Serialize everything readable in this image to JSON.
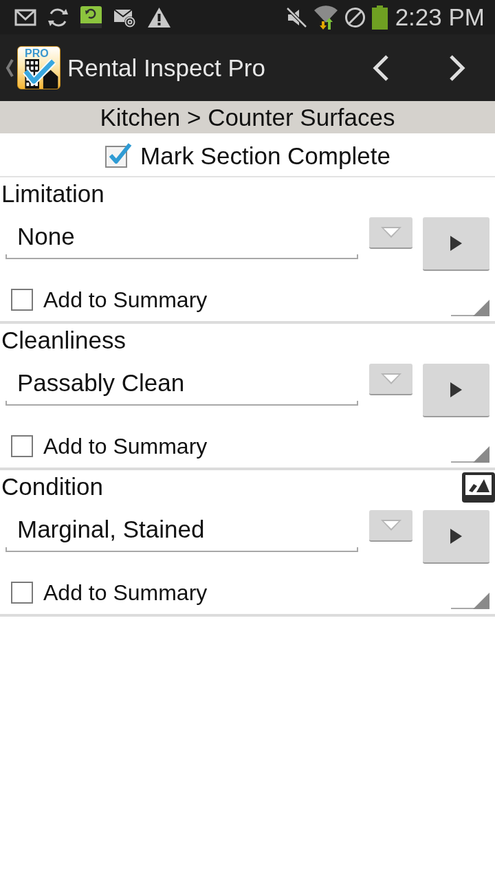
{
  "status_bar": {
    "time": "2:23 PM"
  },
  "action_bar": {
    "logo_badge": "PRO",
    "title": "Rental Inspect Pro"
  },
  "breadcrumb": "Kitchen > Counter Surfaces",
  "mark_complete": {
    "label": "Mark Section Complete",
    "checked": true
  },
  "sections": [
    {
      "label": "Limitation",
      "value": "None",
      "photo_attached": false,
      "add_to_summary": {
        "label": "Add to Summary",
        "checked": false
      }
    },
    {
      "label": "Cleanliness",
      "value": "Passably Clean",
      "photo_attached": false,
      "add_to_summary": {
        "label": "Add to Summary",
        "checked": false
      }
    },
    {
      "label": "Condition",
      "value": "Marginal, Stained",
      "photo_attached": true,
      "add_to_summary": {
        "label": "Add to Summary",
        "checked": false
      }
    }
  ]
}
